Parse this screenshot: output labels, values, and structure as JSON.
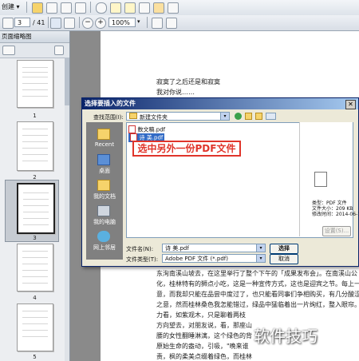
{
  "toolbar": {
    "create_label": "创建",
    "page_current": "3",
    "page_total": "/ 41",
    "zoom": "100%"
  },
  "left_panel": {
    "title": "页面缩略图",
    "thumbnails": [
      "1",
      "2",
      "3",
      "4",
      "5"
    ],
    "selected_thumbnail": "3"
  },
  "document": {
    "lines_top": [
      "寂寞了之后还是和寂寞",
      "我对你说……"
    ],
    "lines_bottom": [
      "东洵南溪山坡去，在这里举行了整个下午的「成果发布会」。在南溪山公",
      "化，桂林特有的狮点小吃，这是一种宣传方式，这也是迎宾之节。每上一",
      "意，而我却只能在品尝中度过了，也只能看同事们争相购买，有几分酸涩",
      "之意，然而桂林桑色我怎能错过，绿品中猛临着出一片绚红，整入眼帘。",
      "力看，如紫观木，只是聊着两枝",
      "方向望去，对朋友说，看，那座山",
      "腰的女性翻睡淋漓，这个绿色的背",
      "原始生命的盎动，引吸，\"晚来谁",
      "责，枫的柔美点缀着绿色，而桂林",
      "如果哪是鸟之浪，那些桂了，"
    ]
  },
  "dialog": {
    "title": "选择要插入的文件",
    "look_in_label": "查找范围(I):",
    "look_in_value": "新建文件夹",
    "places": [
      "Recent",
      "桌面",
      "我的文档",
      "我的电脑",
      "网上邻居"
    ],
    "files": [
      "数文稿.pdf",
      "诗 美.pdf"
    ],
    "selected_file": "诗 美.pdf",
    "preview": {
      "type": "类型：PDF 文件",
      "size": "文件大小：209 KB",
      "modified": "修改时间：2014-06-14",
      "settings_button": "设置(S)..."
    },
    "filename_label": "文件名(N):",
    "filename_value": "诗 美.pdf",
    "filetype_label": "文件类型(T):",
    "filetype_value": "Adobe PDF 文件 (*.pdf)",
    "select_button": "选择",
    "cancel_button": "取消"
  },
  "annotation": {
    "callout": "选中另外一份PDF文件"
  },
  "watermark": "软件技巧",
  "colors": {
    "titlebar": "#0a246a",
    "callout": "#e0352b",
    "places_bg": "#808080"
  }
}
